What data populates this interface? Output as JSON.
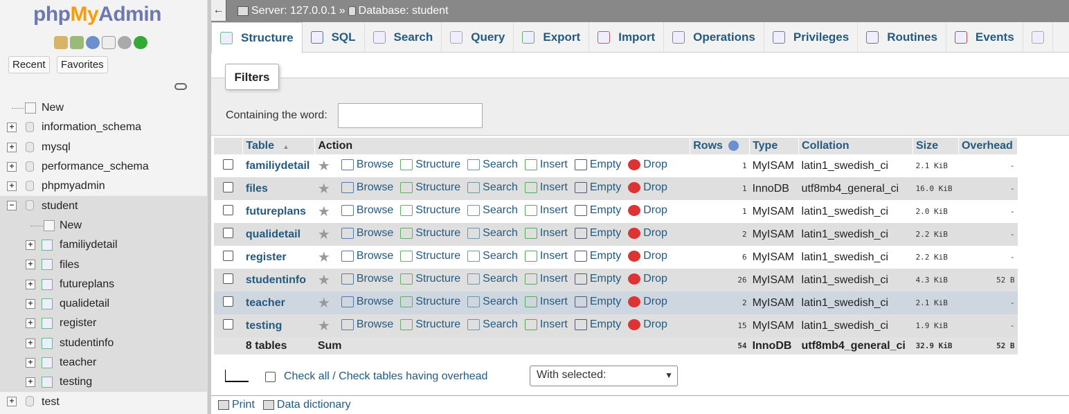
{
  "app": {
    "logo_php": "php",
    "logo_my": "My",
    "logo_admin": "Admin"
  },
  "nav": {
    "recent": "Recent",
    "favorites": "Favorites",
    "tree": [
      {
        "label": "New",
        "kind": "new",
        "level": 0
      },
      {
        "label": "information_schema",
        "kind": "db",
        "level": 0
      },
      {
        "label": "mysql",
        "kind": "db",
        "level": 0
      },
      {
        "label": "performance_schema",
        "kind": "db",
        "level": 0
      },
      {
        "label": "phpmyadmin",
        "kind": "db",
        "level": 0
      },
      {
        "label": "student",
        "kind": "db",
        "level": 0,
        "open": true
      },
      {
        "label": "New",
        "kind": "new",
        "level": 1
      },
      {
        "label": "familiydetail",
        "kind": "table",
        "level": 1
      },
      {
        "label": "files",
        "kind": "table",
        "level": 1
      },
      {
        "label": "futureplans",
        "kind": "table",
        "level": 1
      },
      {
        "label": "qualidetail",
        "kind": "table",
        "level": 1
      },
      {
        "label": "register",
        "kind": "table",
        "level": 1
      },
      {
        "label": "studentinfo",
        "kind": "table",
        "level": 1
      },
      {
        "label": "teacher",
        "kind": "table",
        "level": 1
      },
      {
        "label": "testing",
        "kind": "table",
        "level": 1
      },
      {
        "label": "test",
        "kind": "db",
        "level": 0
      }
    ]
  },
  "topbar": {
    "back": "←",
    "server": "Server: 127.0.0.1",
    "sep": "»",
    "database": "Database: student"
  },
  "tabs": [
    {
      "label": "Structure",
      "active": true
    },
    {
      "label": "SQL"
    },
    {
      "label": "Search"
    },
    {
      "label": "Query"
    },
    {
      "label": "Export"
    },
    {
      "label": "Import"
    },
    {
      "label": "Operations"
    },
    {
      "label": "Privileges"
    },
    {
      "label": "Routines"
    },
    {
      "label": "Events"
    }
  ],
  "filters": {
    "legend": "Filters",
    "label": "Containing the word:",
    "value": ""
  },
  "table": {
    "headers": {
      "table": "Table",
      "action": "Action",
      "rows": "Rows",
      "type": "Type",
      "collation": "Collation",
      "size": "Size",
      "overhead": "Overhead"
    },
    "sort_indicator": "▲",
    "actions": [
      "Browse",
      "Structure",
      "Search",
      "Insert",
      "Empty",
      "Drop"
    ],
    "rows": [
      {
        "name": "familiydetail",
        "rows": "1",
        "type": "MyISAM",
        "collation": "latin1_swedish_ci",
        "size": "2.1 KiB",
        "overhead": "-"
      },
      {
        "name": "files",
        "rows": "1",
        "type": "InnoDB",
        "collation": "utf8mb4_general_ci",
        "size": "16.0 KiB",
        "overhead": "-"
      },
      {
        "name": "futureplans",
        "rows": "1",
        "type": "MyISAM",
        "collation": "latin1_swedish_ci",
        "size": "2.0 KiB",
        "overhead": "-"
      },
      {
        "name": "qualidetail",
        "rows": "2",
        "type": "MyISAM",
        "collation": "latin1_swedish_ci",
        "size": "2.2 KiB",
        "overhead": "-"
      },
      {
        "name": "register",
        "rows": "6",
        "type": "MyISAM",
        "collation": "latin1_swedish_ci",
        "size": "2.2 KiB",
        "overhead": "-"
      },
      {
        "name": "studentinfo",
        "rows": "26",
        "type": "MyISAM",
        "collation": "latin1_swedish_ci",
        "size": "4.3 KiB",
        "overhead": "52 B"
      },
      {
        "name": "teacher",
        "rows": "2",
        "type": "MyISAM",
        "collation": "latin1_swedish_ci",
        "size": "2.1 KiB",
        "overhead": "-"
      },
      {
        "name": "testing",
        "rows": "15",
        "type": "MyISAM",
        "collation": "latin1_swedish_ci",
        "size": "1.9 KiB",
        "overhead": "-"
      }
    ],
    "footer": {
      "count": "8 tables",
      "sum": "Sum",
      "rows": "54",
      "type": "InnoDB",
      "collation": "utf8mb4_general_ci",
      "size": "32.9 KiB",
      "overhead": "52 B"
    }
  },
  "bottom": {
    "check_all": "Check all",
    "slash": "/",
    "check_overhead": "Check tables having overhead",
    "with_selected": "With selected:"
  },
  "footer": {
    "print": "Print",
    "dictionary": "Data dictionary"
  }
}
